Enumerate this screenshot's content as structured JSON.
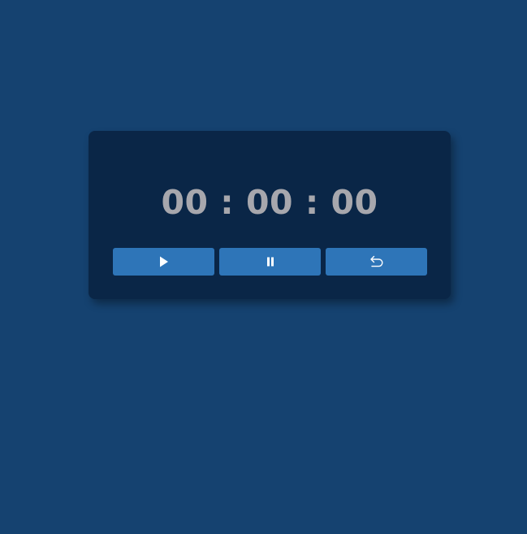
{
  "timer": {
    "hours": "00",
    "minutes": "00",
    "seconds": "00",
    "separator": ":"
  },
  "controls": [
    {
      "name": "start-button",
      "icon": "play-icon"
    },
    {
      "name": "pause-button",
      "icon": "pause-icon"
    },
    {
      "name": "reset-button",
      "icon": "reset-icon"
    }
  ],
  "colors": {
    "background": "#154270",
    "card": "#0a2647",
    "digits": "#a7a7ad",
    "button": "#2e75b8",
    "icon": "#ffffff"
  }
}
